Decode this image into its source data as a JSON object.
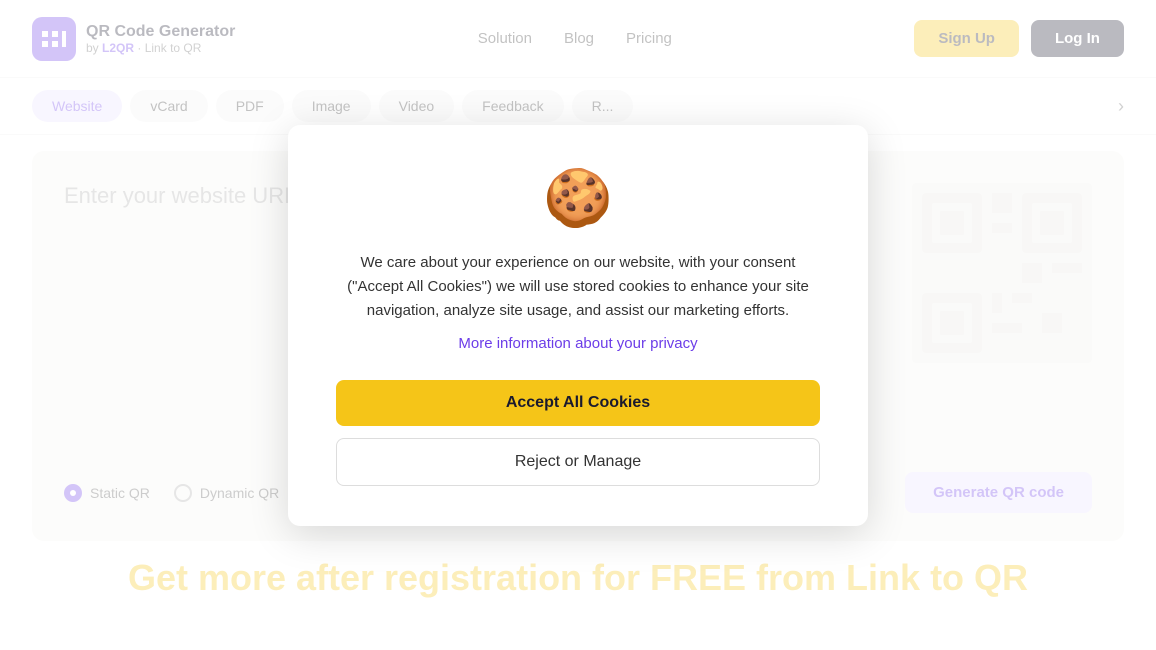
{
  "header": {
    "logo_title": "QR Code Generator",
    "logo_by": "by",
    "logo_brand": "L2QR",
    "logo_subtitle": "Link to QR",
    "nav": [
      {
        "label": "Solution",
        "id": "solution"
      },
      {
        "label": "Blog",
        "id": "blog"
      },
      {
        "label": "Pricing",
        "id": "pricing"
      }
    ],
    "signup_label": "Sign Up",
    "login_label": "Log In"
  },
  "tabs": [
    {
      "label": "Website",
      "active": true
    },
    {
      "label": "vCard"
    },
    {
      "label": "PDF"
    },
    {
      "label": "Image"
    },
    {
      "label": "Video"
    },
    {
      "label": "Feedback"
    },
    {
      "label": "R..."
    }
  ],
  "tabs_arrow": "›",
  "main": {
    "placeholder_text": "Enter your website URL...",
    "radio_static": "Static QR",
    "radio_dynamic": "Dynamic QR",
    "generate_button": "Generate QR code"
  },
  "bottom": {
    "heading_start": "Get more after registration for FREE from Link to QR"
  },
  "cookie_modal": {
    "icon": "🍪",
    "body_text": "We care about your experience on our website, with your consent (\"Accept All Cookies\") we will use stored cookies to enhance your site navigation, analyze site usage, and assist our marketing efforts.",
    "link_text": "More information about your privacy",
    "accept_label": "Accept All Cookies",
    "reject_label": "Reject or Manage"
  }
}
